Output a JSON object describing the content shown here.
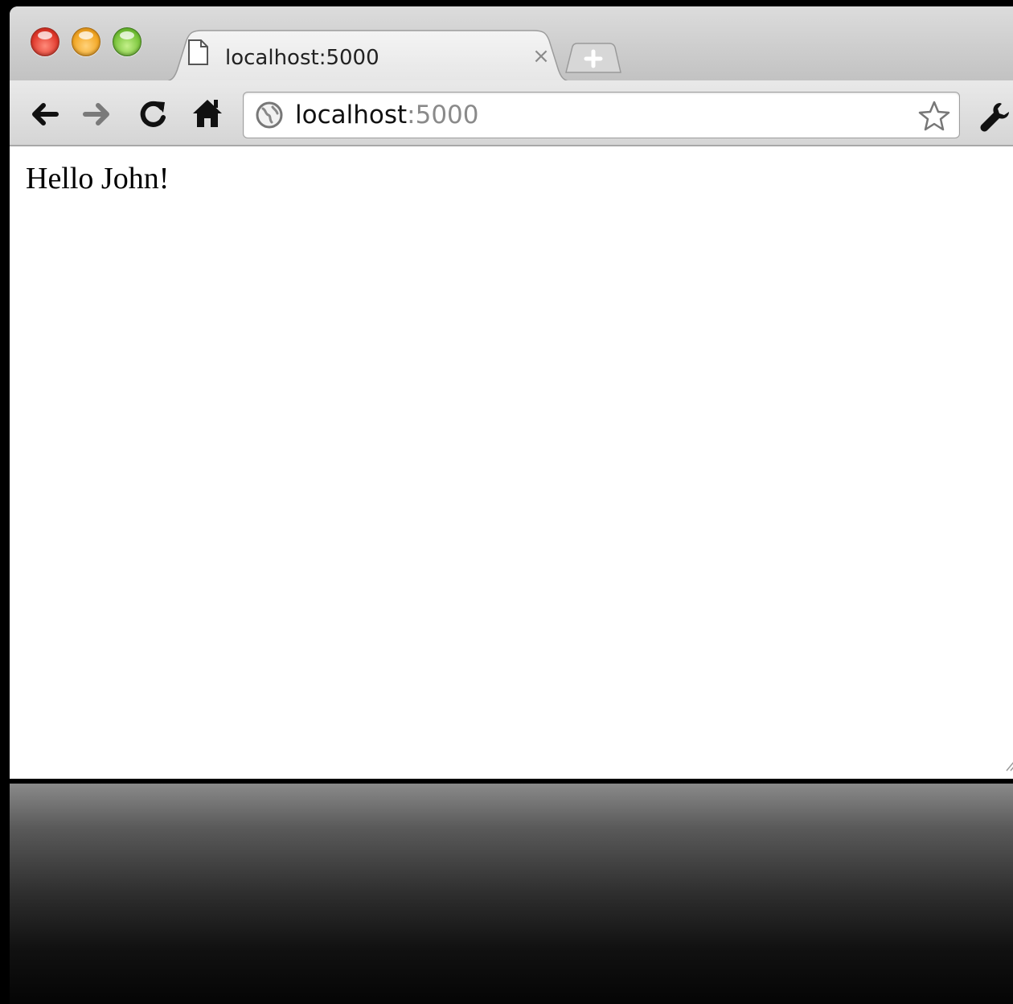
{
  "window": {
    "controls": {
      "close": "close-button",
      "minimize": "minimize-button",
      "zoom": "zoom-button"
    }
  },
  "tab": {
    "title": "localhost:5000",
    "close_glyph": "×",
    "favicon": "page-icon"
  },
  "toolbar": {
    "back_icon": "arrow-left-icon",
    "forward_icon": "arrow-right-icon",
    "reload_icon": "reload-icon",
    "home_icon": "home-icon",
    "menu_icon": "wrench-icon"
  },
  "address_bar": {
    "host": "localhost",
    "port": ":5000",
    "site_icon": "globe-icon",
    "bookmark_icon": "star-icon"
  },
  "page": {
    "greeting": "Hello John!"
  }
}
